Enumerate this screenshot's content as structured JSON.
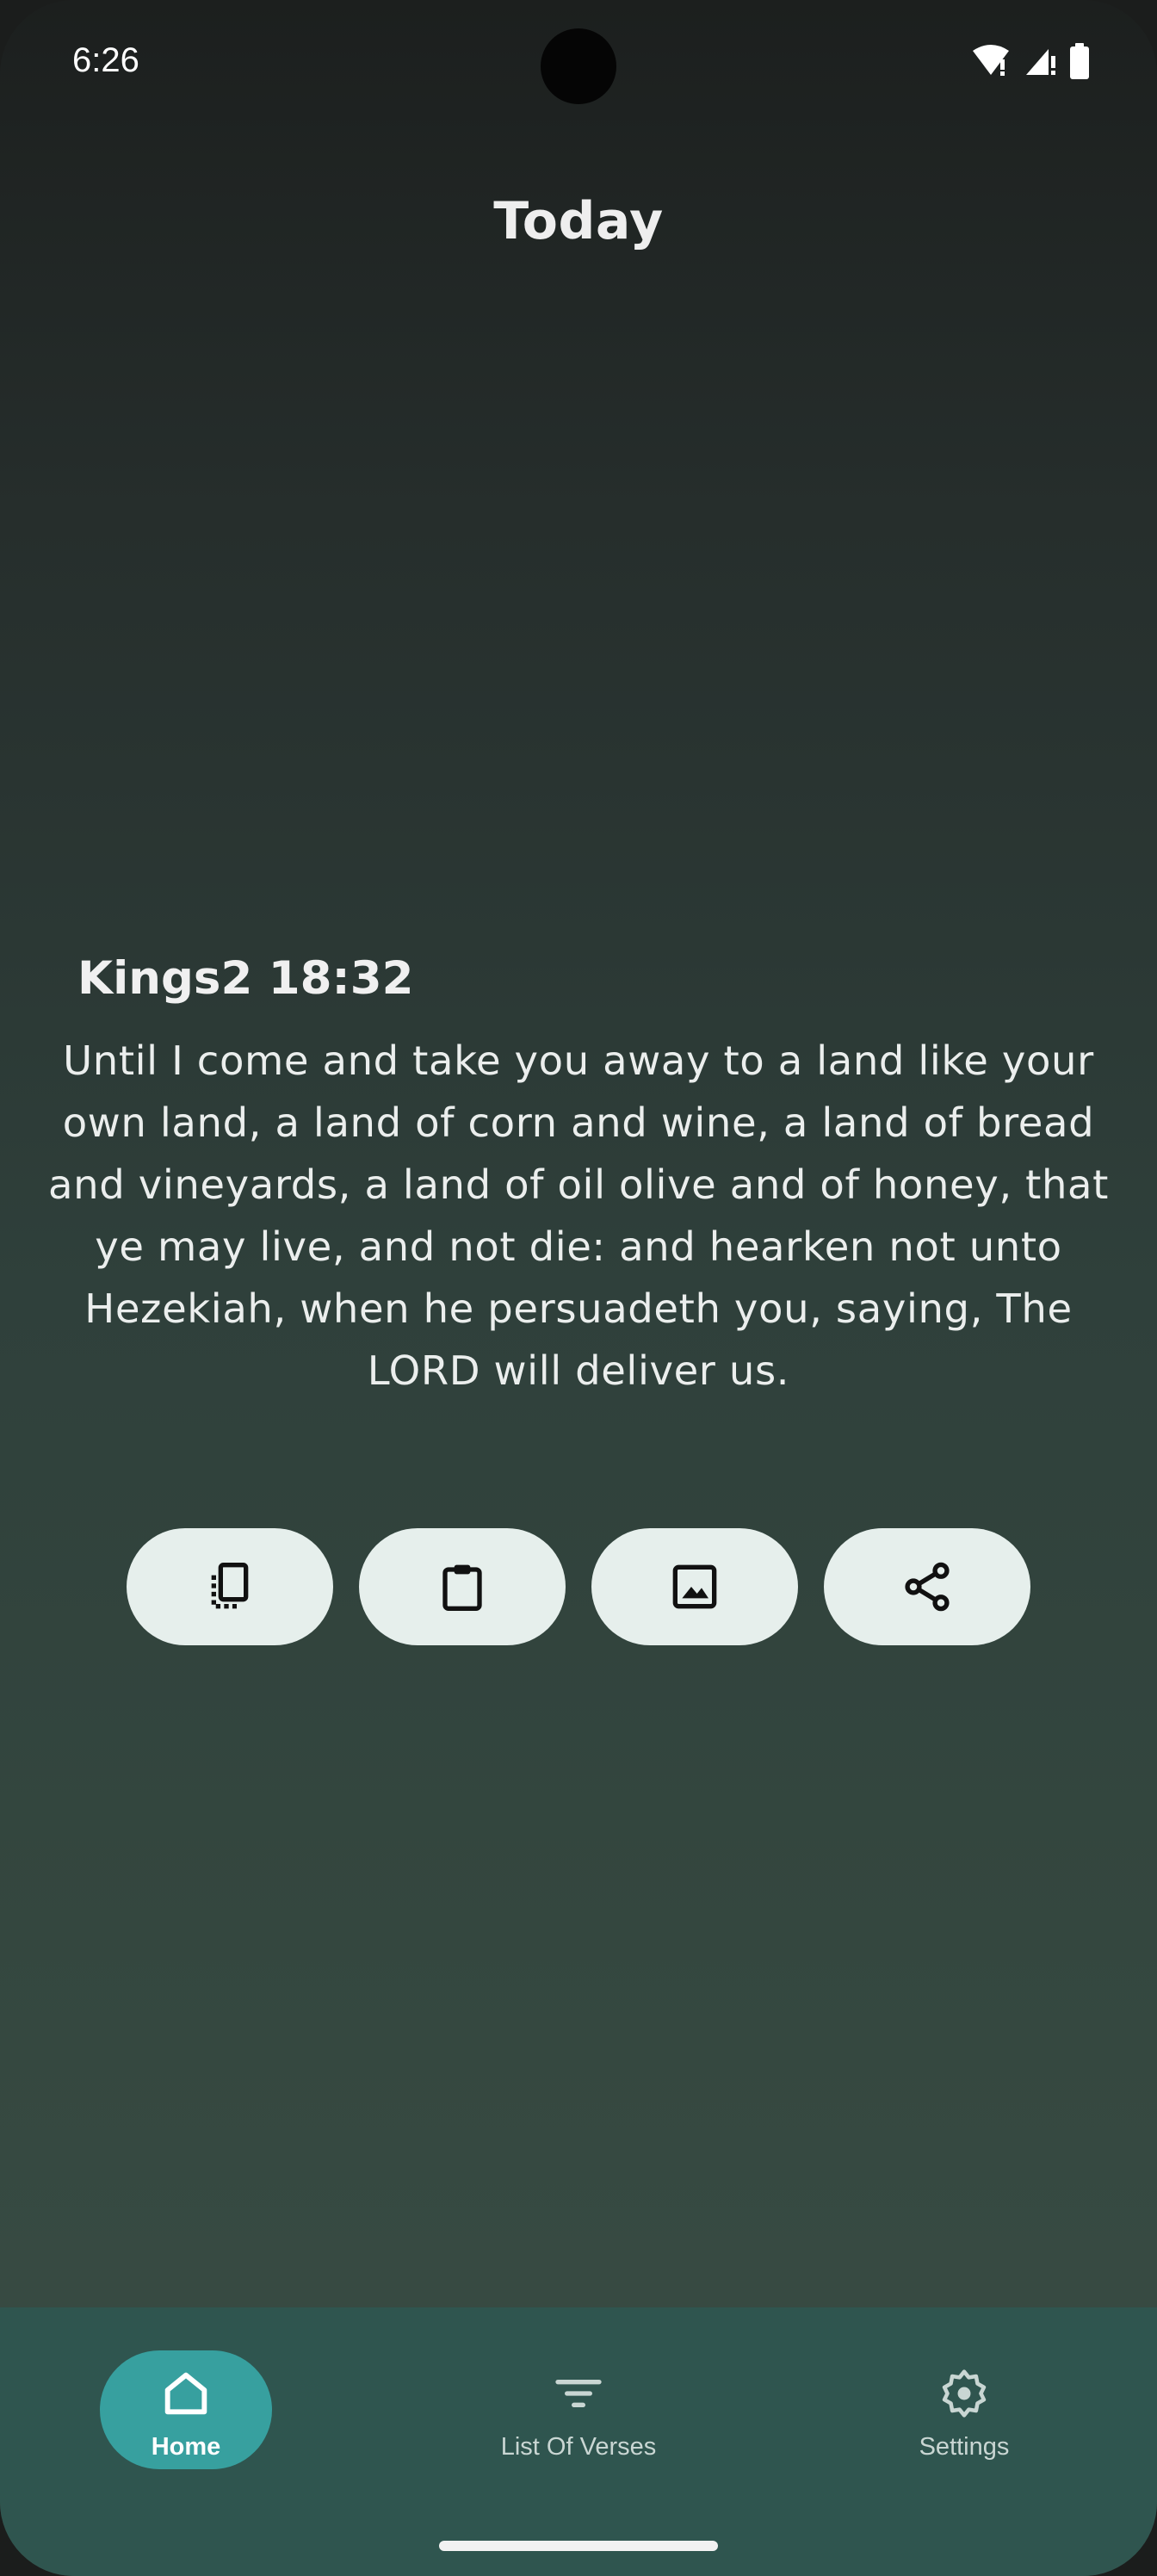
{
  "status_bar": {
    "time": "6:26"
  },
  "header": {
    "title": "Today"
  },
  "verse": {
    "reference": "Kings2 18:32",
    "text": "Until I come and take you away to a land like your own land, a land of corn and wine, a land of bread and vineyards, a land of oil olive and of honey, that ye may live, and not die: and hearken not unto Hezekiah, when he persuadeth you, saying, The LORD will deliver us."
  },
  "actions": [
    {
      "icon": "copy-icon"
    },
    {
      "icon": "clipboard-icon"
    },
    {
      "icon": "image-icon"
    },
    {
      "icon": "share-icon"
    }
  ],
  "bottom_nav": {
    "items": [
      {
        "label": "Home",
        "icon": "home-icon",
        "selected": true
      },
      {
        "label": "List Of Verses",
        "icon": "filter-icon",
        "selected": false
      },
      {
        "label": "Settings",
        "icon": "gear-icon",
        "selected": false
      }
    ]
  },
  "colors": {
    "background_top": "#1c1f1e",
    "background_bottom": "#374a42",
    "action_button_bg": "#e6efec",
    "nav_bar_bg": "#2f554f",
    "nav_selected_pill": "#37a09f"
  }
}
